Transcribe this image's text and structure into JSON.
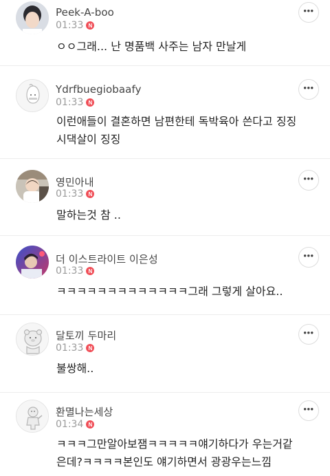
{
  "more_icon": "more-horizontal-icon",
  "new_badge": "N",
  "colors": {
    "badge": "#f04e57",
    "divider": "#ececec",
    "time": "#9a9a9a"
  },
  "comments": [
    {
      "nickname": "Peek-A-boo",
      "time": "01:33",
      "text": "ㅇㅇ그래... 난 명품백 사주는 남자 만날게"
    },
    {
      "nickname": "Ydrfbuegiobaafy",
      "time": "01:33",
      "text": "이런애들이 결혼하면 남편한테 독박육아 쓴다고 징징\n시댁살이 징징"
    },
    {
      "nickname": "영민아내",
      "time": "01:33",
      "text": "말하는것 참 .."
    },
    {
      "nickname": "더 이스트라이트 이은성",
      "time": "01:33",
      "text": "ㅋㅋㅋㅋㅋㅋㅋㅋㅋㅋㅋㅋㅋ그래 그렇게 살아요.."
    },
    {
      "nickname": "달토끼 두마리",
      "time": "01:33",
      "text": "불쌍해.."
    },
    {
      "nickname": "환멸나는세상",
      "time": "01:34",
      "text": "ㅋㅋㅋ그만알아보잼ㅋㅋㅋㅋㅋ얘기하다가 우는거같\n은데?ㅋㅋㅋㅋ본인도 얘기하면서 광광우는느낌"
    }
  ]
}
